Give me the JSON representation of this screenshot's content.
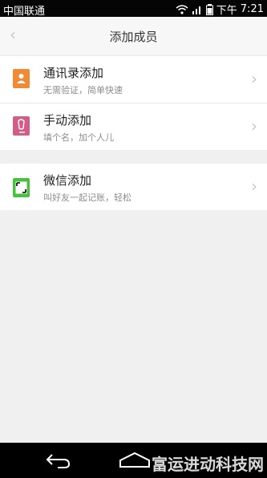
{
  "status_bar": {
    "carrier": "中国联通",
    "time_prefix": "下午",
    "time": "7:21"
  },
  "header": {
    "back_icon": "chevron-left-icon",
    "title": "添加成员"
  },
  "group1": [
    {
      "title": "通讯录添加",
      "subtitle": "无需验证，简单快速",
      "icon": "contacts-icon",
      "color": "#f08a34"
    },
    {
      "title": "手动添加",
      "subtitle": "填个名，加个人儿",
      "icon": "hand-write-icon",
      "color": "#d35d86"
    }
  ],
  "group2": [
    {
      "title": "微信添加",
      "subtitle": "叫好友一起记账，轻松",
      "icon": "wechat-scan-icon",
      "color": "#48c13f"
    }
  ],
  "navbar": {
    "back_icon": "back-arrow-icon",
    "home_icon": "home-icon",
    "watermark": "富运进动科技网"
  }
}
